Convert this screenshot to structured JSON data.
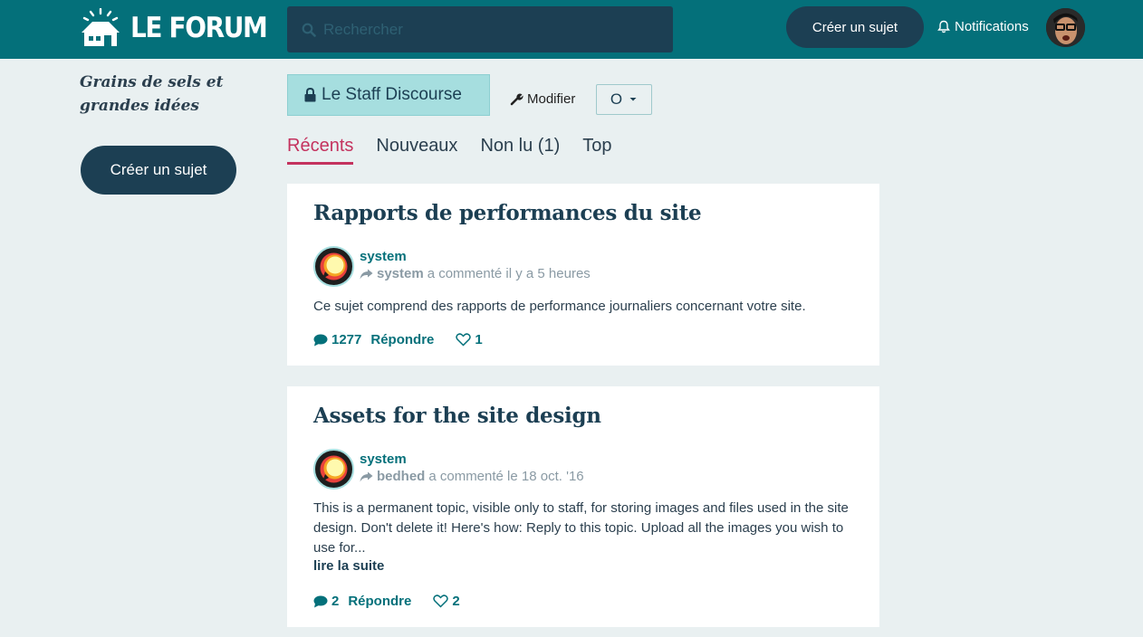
{
  "header": {
    "logo_text": "LE FORUM",
    "search_placeholder": "Rechercher",
    "create_label": "Créer un sujet",
    "notifications_label": "Notifications"
  },
  "sidebar": {
    "tagline": "Grains de sels et grandes idées",
    "create_label": "Créer un sujet"
  },
  "category": {
    "name": "Le Staff Discourse",
    "modify_label": "Modifier",
    "notification_level": "O"
  },
  "tabs": [
    {
      "label": "Récents",
      "active": true
    },
    {
      "label": "Nouveaux",
      "active": false
    },
    {
      "label": "Non lu (1)",
      "active": false
    },
    {
      "label": "Top",
      "active": false
    }
  ],
  "topics": [
    {
      "title": "Rapports de performances du site",
      "poster": "system",
      "last_user": "system",
      "last_activity": "a commenté il y a 5 heures",
      "excerpt": "Ce sujet comprend des rapports de performance journaliers concernant votre site.",
      "read_more": "",
      "replies": "1277",
      "reply_label": "Répondre",
      "likes": "1"
    },
    {
      "title": "Assets for the site design",
      "poster": "system",
      "last_user": "bedhed",
      "last_activity": "a commenté le 18 oct. '16",
      "excerpt": "This is a permanent topic, visible only to staff, for storing images and files used in the site design. Don't delete it! Here's how: Reply to this topic. Upload all the images you wish to use for...",
      "read_more": "lire la suite",
      "replies": "2",
      "reply_label": "Répondre",
      "likes": "2"
    }
  ],
  "colors": {
    "header_bg": "#04707a",
    "dark_button": "#1c3f53",
    "accent_active_tab": "#c4325e",
    "category_badge": "#a6dedf",
    "page_bg": "#e9f0f1"
  }
}
